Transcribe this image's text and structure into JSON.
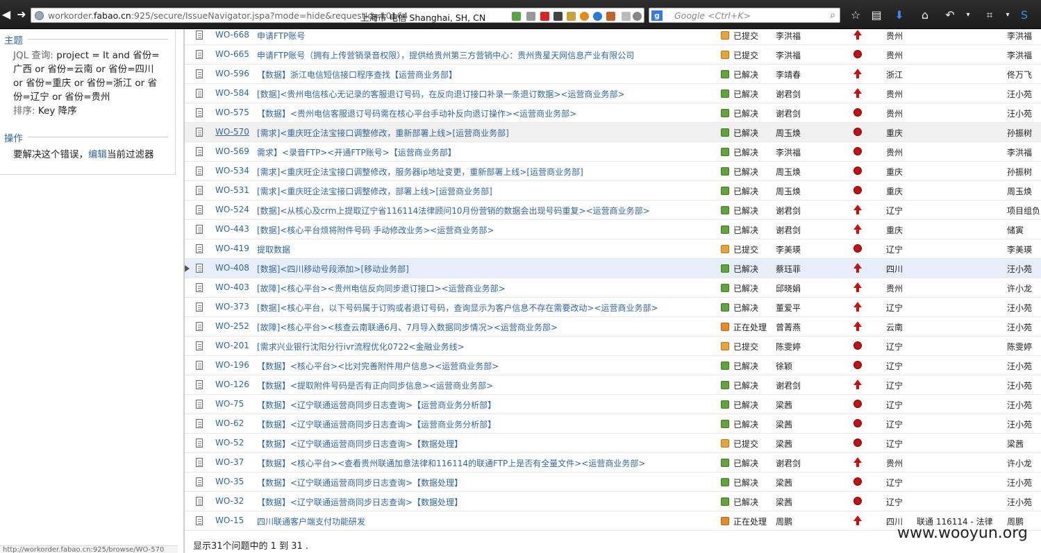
{
  "browser": {
    "url_prefix": "workorder.",
    "url_host": "fabao.cn",
    "url_rest": ":925/secure/IssueNavigator.jspa?mode=hide&requestId=10164",
    "geo": "上海市 电信 Shanghai, SH, CN",
    "search_placeholder": "Google <Ctrl+K>"
  },
  "sidebar": {
    "summary_heading": "主题",
    "jql_label": "JQL 查询:",
    "jql_text": "project = It and 省份=广西 or 省份=云南 or 省份=四川 or 省份=重庆 or 省份=浙江 or 省份=辽宁 or 省份=贵州",
    "sort_label": "排序:",
    "sort_value": "Key 降序",
    "ops_heading": "操作",
    "fix_prefix": "要解决这个错误，",
    "fix_link": "编辑",
    "fix_suffix": "当前过滤器",
    "status_url": "http://workorder.fabao.cn:925/browse/WO-570"
  },
  "issues": [
    {
      "key": "WO-668",
      "summary": "申请FTP账号",
      "status": "已提交",
      "status_type": "sub",
      "reporter": "李洪福",
      "priority": "up",
      "province": "贵州",
      "component": "",
      "assignee": "李洪福"
    },
    {
      "key": "WO-665",
      "summary": "申请FTP账号（拥有上传营销录音权限），提供给贵州第三方营销中心：贵州贵星天网信息产业有限公司",
      "status": "已提交",
      "status_type": "sub",
      "reporter": "李洪福",
      "priority": "crit",
      "province": "贵州",
      "component": "",
      "assignee": "李洪福"
    },
    {
      "key": "WO-596",
      "summary": "【数据】浙江电信短信接口程序查找【运营商业务部】",
      "status": "已解决",
      "status_type": "ok",
      "reporter": "李靖春",
      "priority": "up",
      "province": "浙江",
      "component": "",
      "assignee": "佟万飞"
    },
    {
      "key": "WO-584",
      "summary": "[数据]<贵州电信核心无记录的客服退订号码，在反向退订接口补录一条退订数据><运营商业务部>",
      "status": "已解决",
      "status_type": "ok",
      "reporter": "谢君剑",
      "priority": "up",
      "province": "贵州",
      "component": "",
      "assignee": "汪小苑"
    },
    {
      "key": "WO-575",
      "summary": "【数据】<贵州电信客服退订号码需在核心平台手动补反向退订操作><运营商业务部>",
      "status": "已解决",
      "status_type": "ok",
      "reporter": "谢君剑",
      "priority": "crit",
      "province": "贵州",
      "component": "",
      "assignee": "汪小苑"
    },
    {
      "key": "WO-570",
      "summary": "[需求]<重庆旺企法宝接口调整修改，重新部署上线>[运营商业务部]",
      "status": "已解决",
      "status_type": "ok",
      "reporter": "周玉焕",
      "priority": "crit",
      "province": "重庆",
      "component": "",
      "assignee": "孙振树",
      "hl": true
    },
    {
      "key": "WO-569",
      "summary": "需求】<录音FTP><开通FTP账号>【运营商业务部】",
      "status": "已解决",
      "status_type": "ok",
      "reporter": "李洪福",
      "priority": "crit",
      "province": "贵州",
      "component": "",
      "assignee": "李洪福"
    },
    {
      "key": "WO-534",
      "summary": "[需求]<重庆旺企法宝接口调整修改，服务器ip地址变更，重新部署上线>[运营商业务部]",
      "status": "已解决",
      "status_type": "ok",
      "reporter": "周玉焕",
      "priority": "crit",
      "province": "重庆",
      "component": "",
      "assignee": "孙振树"
    },
    {
      "key": "WO-531",
      "summary": "[需求]<重庆旺企法宝接口调整修改，部署上线>[运营商业务部]",
      "status": "已解决",
      "status_type": "ok",
      "reporter": "周玉焕",
      "priority": "crit",
      "province": "重庆",
      "component": "",
      "assignee": "周玉焕"
    },
    {
      "key": "WO-524",
      "summary": "[数据]<从核心及crm上提取辽宁省116114法律顾问10月份营销的数据会出现号码重复><运营商业务部>",
      "status": "已解决",
      "status_type": "ok",
      "reporter": "谢君剑",
      "priority": "up",
      "province": "辽宁",
      "component": "",
      "assignee": "项目组负"
    },
    {
      "key": "WO-443",
      "summary": "[数据]<核心平台烦将附件号码 手动修改业务><运营商业务部>",
      "status": "已解决",
      "status_type": "ok",
      "reporter": "谢君剑",
      "priority": "up",
      "province": "重庆",
      "component": "",
      "assignee": "储寅"
    },
    {
      "key": "WO-419",
      "summary": "提取数据",
      "status": "已提交",
      "status_type": "sub",
      "reporter": "李美瑛",
      "priority": "crit",
      "province": "辽宁",
      "component": "",
      "assignee": "李美瑛"
    },
    {
      "key": "WO-408",
      "summary": "[数据]<四川移动号段添加>[移动业务部]",
      "status": "已解决",
      "status_type": "ok",
      "reporter": "蔡珏菲",
      "priority": "up",
      "province": "四川",
      "component": "",
      "assignee": "汪小苑",
      "sel": true
    },
    {
      "key": "WO-403",
      "summary": "[故障]<核心平台><贵州电信反向同步退订接口><运营商业务部>",
      "status": "已解决",
      "status_type": "ok",
      "reporter": "邱晓娟",
      "priority": "up",
      "province": "贵州",
      "component": "",
      "assignee": "许小龙"
    },
    {
      "key": "WO-373",
      "summary": "[数据]<核心平台，以下号码属于订购或者退订号码，查询显示为客户信息不存在需要改动><运营商业务部>",
      "status": "已解决",
      "status_type": "ok",
      "reporter": "董爱平",
      "priority": "up",
      "province": "辽宁",
      "component": "",
      "assignee": "汪小苑"
    },
    {
      "key": "WO-252",
      "summary": "[故障]<核心平台><核查云南联通6月、7月导入数据同步情况><运营商业务部>",
      "status": "正在处理",
      "status_type": "prog",
      "reporter": "曾菁燕",
      "priority": "up",
      "province": "云南",
      "component": "",
      "assignee": "汪小苑"
    },
    {
      "key": "WO-201",
      "summary": "[需求兴业银行沈阳分行ivr流程优化0722<金融业务线>",
      "status": "已提交",
      "status_type": "sub",
      "reporter": "陈雯婷",
      "priority": "crit",
      "province": "辽宁",
      "component": "",
      "assignee": "陈雯婷"
    },
    {
      "key": "WO-196",
      "summary": "【数据】<核心平台><比对完善附件用户信息><运营商业务部>",
      "status": "已解决",
      "status_type": "ok",
      "reporter": "徐颖",
      "priority": "crit",
      "province": "辽宁",
      "component": "",
      "assignee": "汪小苑"
    },
    {
      "key": "WO-126",
      "summary": "【数据】<提取附件号码是否有正向同步信息><运营商业务部>",
      "status": "已解决",
      "status_type": "ok",
      "reporter": "谢君剑",
      "priority": "up",
      "province": "辽宁",
      "component": "",
      "assignee": "汪小苑"
    },
    {
      "key": "WO-75",
      "summary": "【数据】<辽宁联通运营商同步日志查询>【运营商业务分析部】",
      "status": "已解决",
      "status_type": "ok",
      "reporter": "梁茜",
      "priority": "crit",
      "province": "辽宁",
      "component": "",
      "assignee": "汪小苑"
    },
    {
      "key": "WO-62",
      "summary": "【数据】<辽宁联通运营商同步日志查询>【运营商业务分析部】",
      "status": "已解决",
      "status_type": "ok",
      "reporter": "梁茜",
      "priority": "crit",
      "province": "辽宁",
      "component": "",
      "assignee": "汪小苑"
    },
    {
      "key": "WO-52",
      "summary": "【数据】<辽宁联通运营商同步日志查询>【数据处理】",
      "status": "已提交",
      "status_type": "sub",
      "reporter": "梁茜",
      "priority": "crit",
      "province": "辽宁",
      "component": "",
      "assignee": "梁茜"
    },
    {
      "key": "WO-37",
      "summary": "【数据】<核心平台><查看贵州联通加意法律和116114的联通FTP上是否有全量文件><运营商业务部>",
      "status": "已解决",
      "status_type": "ok",
      "reporter": "谢君剑",
      "priority": "up",
      "province": "贵州",
      "component": "",
      "assignee": "许小龙"
    },
    {
      "key": "WO-35",
      "summary": "【数据】<辽宁联通运营商同步日志查询>【数据处理】",
      "status": "已解决",
      "status_type": "ok",
      "reporter": "梁茜",
      "priority": "crit",
      "province": "辽宁",
      "component": "",
      "assignee": "汪小苑"
    },
    {
      "key": "WO-32",
      "summary": "【数据】<辽宁联通运营商同步日志查询>【数据处理】",
      "status": "已解决",
      "status_type": "ok",
      "reporter": "梁茜",
      "priority": "crit",
      "province": "辽宁",
      "component": "",
      "assignee": "汪小苑"
    },
    {
      "key": "WO-15",
      "summary": "四川联通客户端支付功能研发",
      "status": "正在处理",
      "status_type": "prog",
      "reporter": "周鹏",
      "priority": "up",
      "province": "四川",
      "component": "联通 116114 - 法律",
      "assignee": "周鹏"
    }
  ],
  "footer": "显示31个问题中的 1 到 31 .",
  "watermark": "www.wooyun.org"
}
